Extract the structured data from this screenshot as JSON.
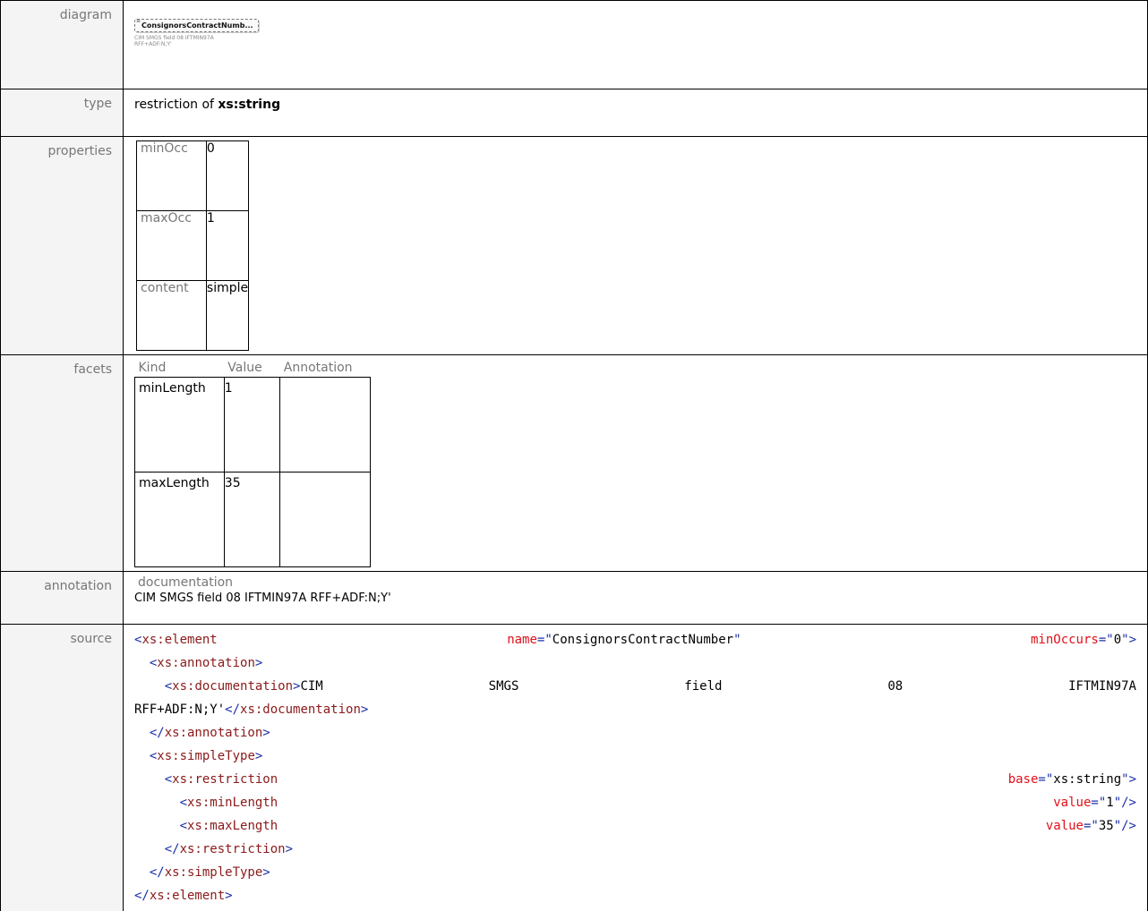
{
  "rows": {
    "diagram": {
      "label": "diagram",
      "box_text": "ConsignorsContractNumb...",
      "caption_line1": "CIM SMGS field 08 IFTMIN97A",
      "caption_line2": "RFF+ADF:N;Y'"
    },
    "type": {
      "label": "type",
      "prefix": "restriction of ",
      "base": "xs:string"
    },
    "properties": {
      "label": "properties",
      "items": [
        {
          "key": "minOcc",
          "value": "0"
        },
        {
          "key": "maxOcc",
          "value": "1"
        },
        {
          "key": "content",
          "value": "simple"
        }
      ]
    },
    "facets": {
      "label": "facets",
      "headers": [
        "Kind",
        "Value",
        "Annotation"
      ],
      "items": [
        {
          "kind": "minLength",
          "value": "1"
        },
        {
          "kind": "maxLength",
          "value": "35"
        }
      ]
    },
    "annotation": {
      "label": "annotation",
      "heading": "documentation",
      "text": "CIM SMGS field 08 IFTMIN97A RFF+ADF:N;Y'"
    },
    "source": {
      "label": "source",
      "element_name": "ConsignorsContractNumber",
      "min_occurs": "0",
      "doc_words": [
        "CIM",
        "SMGS",
        "field",
        "08",
        "IFTMIN97A"
      ],
      "doc_tail": "RFF+ADF:N;Y'",
      "base": "xs:string",
      "min_length": "1",
      "max_length": "35"
    }
  }
}
